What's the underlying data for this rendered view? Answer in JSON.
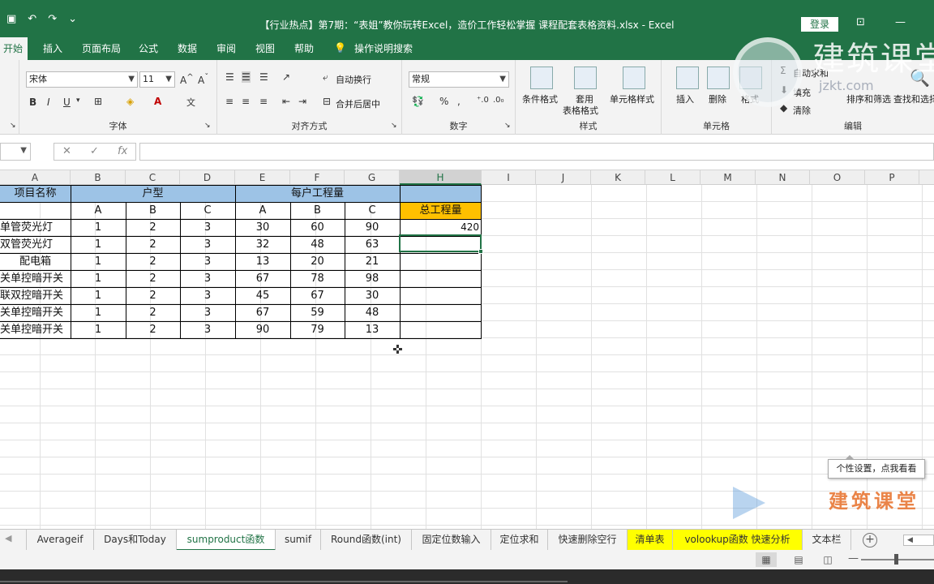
{
  "window": {
    "title": "【行业热点】第7期：“表姐”教你玩转Excel，造价工作轻松掌握  课程配套表格资料.xlsx  -  Excel",
    "login_label": "登录"
  },
  "menu": {
    "tabs": [
      "开始",
      "插入",
      "页面布局",
      "公式",
      "数据",
      "审阅",
      "视图",
      "帮助"
    ],
    "tellme": "操作说明搜索"
  },
  "ribbon": {
    "font_name": "宋体",
    "font_size": "11",
    "number_format": "常规",
    "wrap_text": "自动换行",
    "merge_center": "合并后居中",
    "conditional_format": "条件格式",
    "table_format_1": "套用",
    "table_format_2": "表格格式",
    "cell_style": "单元格样式",
    "insert": "插入",
    "delete": "删除",
    "format": "格式",
    "autosum": "自动求和",
    "fill": "填充",
    "clear": "清除",
    "sort_filter": "排序和筛选",
    "find_select": "查找和选择",
    "groups": {
      "font": "字体",
      "alignment": "对齐方式",
      "number": "数字",
      "styles": "样式",
      "cells": "单元格",
      "editing": "编辑"
    }
  },
  "watermark": {
    "brand": "建筑课堂",
    "url": "jzkt.com",
    "float_text": "建筑课堂"
  },
  "formula_bar": {
    "fx_label": "fx",
    "value": ""
  },
  "columns": [
    "A",
    "B",
    "C",
    "D",
    "E",
    "F",
    "G",
    "H",
    "I",
    "J",
    "K",
    "L",
    "M",
    "N",
    "O",
    "P"
  ],
  "sheet": {
    "header_name": "项目名称",
    "header_type": "户型",
    "header_work": "每户工程量",
    "header_total": "总工程量",
    "sub_headers": [
      "A",
      "B",
      "C",
      "A",
      "B",
      "C"
    ],
    "rows": [
      {
        "name": "单管荧光灯",
        "b": "1",
        "c": "2",
        "d": "3",
        "e": "30",
        "f": "60",
        "g": "90",
        "h": "420"
      },
      {
        "name": "双管荧光灯",
        "b": "1",
        "c": "2",
        "d": "3",
        "e": "32",
        "f": "48",
        "g": "63",
        "h": ""
      },
      {
        "name": "配电箱",
        "b": "1",
        "c": "2",
        "d": "3",
        "e": "13",
        "f": "20",
        "g": "21",
        "h": ""
      },
      {
        "name": "关单控暗开关",
        "b": "1",
        "c": "2",
        "d": "3",
        "e": "67",
        "f": "78",
        "g": "98",
        "h": ""
      },
      {
        "name": "联双控暗开关",
        "b": "1",
        "c": "2",
        "d": "3",
        "e": "45",
        "f": "67",
        "g": "30",
        "h": ""
      },
      {
        "name": "关单控暗开关",
        "b": "1",
        "c": "2",
        "d": "3",
        "e": "67",
        "f": "59",
        "g": "48",
        "h": ""
      },
      {
        "name": "关单控暗开关",
        "b": "1",
        "c": "2",
        "d": "3",
        "e": "90",
        "f": "79",
        "g": "13",
        "h": ""
      }
    ]
  },
  "sheet_tabs": [
    "Averageif",
    "Days和Today",
    "sumproduct函数",
    "sumif",
    "Round函数(int)",
    "固定位数输入",
    "定位求和",
    "快速删除空行",
    "清单表",
    "volookup函数 快速分析",
    "文本栏"
  ],
  "tooltip": "个性设置，点我看看"
}
